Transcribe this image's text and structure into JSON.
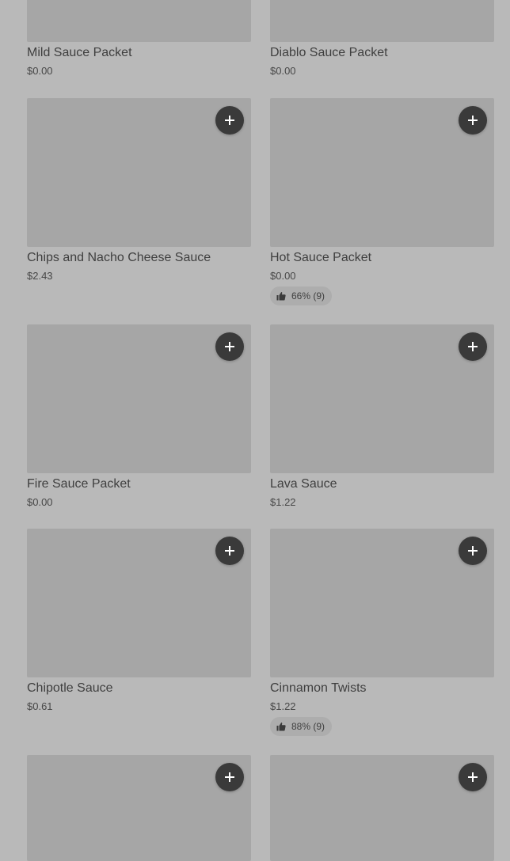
{
  "items": [
    {
      "name": "Mild Sauce Packet",
      "price": "$0.00"
    },
    {
      "name": "Diablo Sauce Packet",
      "price": "$0.00"
    },
    {
      "name": "Chips and Nacho Cheese Sauce",
      "price": "$2.43"
    },
    {
      "name": "Hot Sauce Packet",
      "price": "$0.00",
      "rating": "66% (9)"
    },
    {
      "name": "Fire Sauce Packet",
      "price": "$0.00"
    },
    {
      "name": "Lava Sauce",
      "price": "$1.22"
    },
    {
      "name": "Chipotle Sauce",
      "price": "$0.61"
    },
    {
      "name": "Cinnamon Twists",
      "price": "$1.22",
      "rating": "88% (9)"
    },
    {
      "name": "",
      "price": ""
    },
    {
      "name": "",
      "price": ""
    }
  ],
  "icons": {
    "add": "plus-icon",
    "rating": "thumbs-up-icon"
  },
  "colors": {
    "background": "#b9b9b9",
    "thumbnail": "#a6a6a6",
    "add_button": "#3a3a3a",
    "rating_pill": "#adadad",
    "text": "#3f3f3f"
  }
}
